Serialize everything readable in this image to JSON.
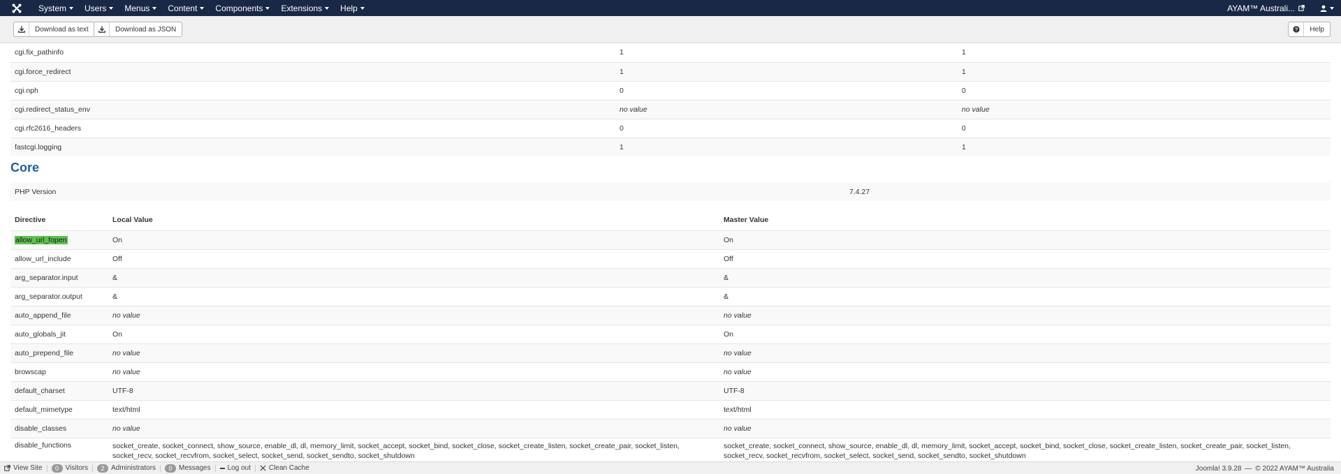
{
  "navbar": {
    "menu": [
      {
        "label": "System"
      },
      {
        "label": "Users"
      },
      {
        "label": "Menus"
      },
      {
        "label": "Content"
      },
      {
        "label": "Components"
      },
      {
        "label": "Extensions"
      },
      {
        "label": "Help"
      }
    ],
    "site_name": "AYAM™ Australi..."
  },
  "toolbar": {
    "download_text": "Download as text",
    "download_json": "Download as JSON",
    "help": "Help"
  },
  "cgi_rows": [
    {
      "directive": "cgi.fix_pathinfo",
      "local": "1",
      "master": "1"
    },
    {
      "directive": "cgi.force_redirect",
      "local": "1",
      "master": "1"
    },
    {
      "directive": "cgi.nph",
      "local": "0",
      "master": "0"
    },
    {
      "directive": "cgi.redirect_status_env",
      "local": "no value",
      "master": "no value"
    },
    {
      "directive": "cgi.rfc2616_headers",
      "local": "0",
      "master": "0"
    },
    {
      "directive": "fastcgi.logging",
      "local": "1",
      "master": "1"
    }
  ],
  "core": {
    "title": "Core",
    "php_version_label": "PHP Version",
    "php_version_value": "7.4.27",
    "headers": {
      "directive": "Directive",
      "local": "Local Value",
      "master": "Master Value"
    },
    "rows": [
      {
        "directive": "allow_url_fopen",
        "local": "On",
        "master": "On"
      },
      {
        "directive": "allow_url_include",
        "local": "Off",
        "master": "Off"
      },
      {
        "directive": "arg_separator.input",
        "local": "&",
        "master": "&"
      },
      {
        "directive": "arg_separator.output",
        "local": "&",
        "master": "&"
      },
      {
        "directive": "auto_append_file",
        "local": "no value",
        "master": "no value"
      },
      {
        "directive": "auto_globals_jit",
        "local": "On",
        "master": "On"
      },
      {
        "directive": "auto_prepend_file",
        "local": "no value",
        "master": "no value"
      },
      {
        "directive": "browscap",
        "local": "no value",
        "master": "no value"
      },
      {
        "directive": "default_charset",
        "local": "UTF-8",
        "master": "UTF-8"
      },
      {
        "directive": "default_mimetype",
        "local": "text/html",
        "master": "text/html"
      },
      {
        "directive": "disable_classes",
        "local": "no value",
        "master": "no value"
      },
      {
        "directive": "disable_functions",
        "local": "socket_create, socket_connect, show_source, enable_dl, dl, memory_limit, socket_accept, socket_bind, socket_close, socket_create_listen, socket_create_pair, socket_listen, socket_recv, socket_recvfrom, socket_select, socket_send, socket_sendto, socket_shutdown",
        "master": "socket_create, socket_connect, show_source, enable_dl, dl, memory_limit, socket_accept, socket_bind, socket_close, socket_create_listen, socket_create_pair, socket_listen, socket_recv, socket_recvfrom, socket_select, socket_send, socket_sendto, socket_shutdown"
      }
    ]
  },
  "statusbar": {
    "view_site": "View Site",
    "visitors_count": "0",
    "visitors": "Visitors",
    "admins_count": "2",
    "admins": "Administrators",
    "messages_count": "0",
    "messages": "Messages",
    "logout": "Log out",
    "clean_cache": "Clean Cache",
    "version": "Joomla! 3.9.28",
    "dash": "—",
    "copyright": "© 2022 AYAM™ Australia"
  },
  "colors": {
    "navbar": "#182846",
    "section_title": "#1c5fa2",
    "highlight": "#5ec14f"
  }
}
